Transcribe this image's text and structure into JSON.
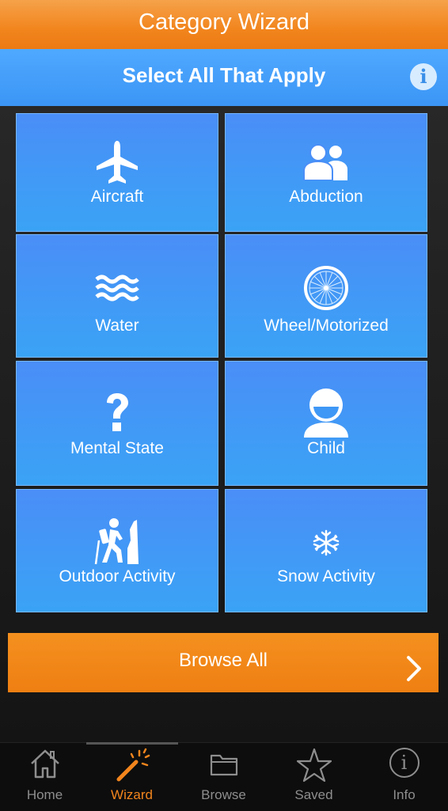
{
  "header": {
    "title": "Category Wizard"
  },
  "subheader": {
    "title": "Select All That Apply",
    "info_glyph": "i"
  },
  "tiles": [
    {
      "label": "Aircraft",
      "icon": "airplane-icon"
    },
    {
      "label": "Abduction",
      "icon": "people-icon"
    },
    {
      "label": "Water",
      "icon": "waves-icon"
    },
    {
      "label": "Wheel/Motorized",
      "icon": "wheel-icon"
    },
    {
      "label": "Mental State",
      "icon": "question-icon"
    },
    {
      "label": "Child",
      "icon": "child-face-icon"
    },
    {
      "label": "Outdoor Activity",
      "icon": "hiker-icon"
    },
    {
      "label": "Snow Activity",
      "icon": "snowflake-icon"
    }
  ],
  "browse_all": {
    "label": "Browse All"
  },
  "tabbar": {
    "items": [
      {
        "label": "Home",
        "icon": "home-icon"
      },
      {
        "label": "Wizard",
        "icon": "magic-wand-icon",
        "active": true
      },
      {
        "label": "Browse",
        "icon": "folder-icon"
      },
      {
        "label": "Saved",
        "icon": "star-icon"
      },
      {
        "label": "Info",
        "icon": "info-icon",
        "glyph": "i"
      }
    ]
  },
  "colors": {
    "orange": "#f2851d",
    "blue": "#3b95f5",
    "tab_inactive": "#8e8e8e"
  }
}
